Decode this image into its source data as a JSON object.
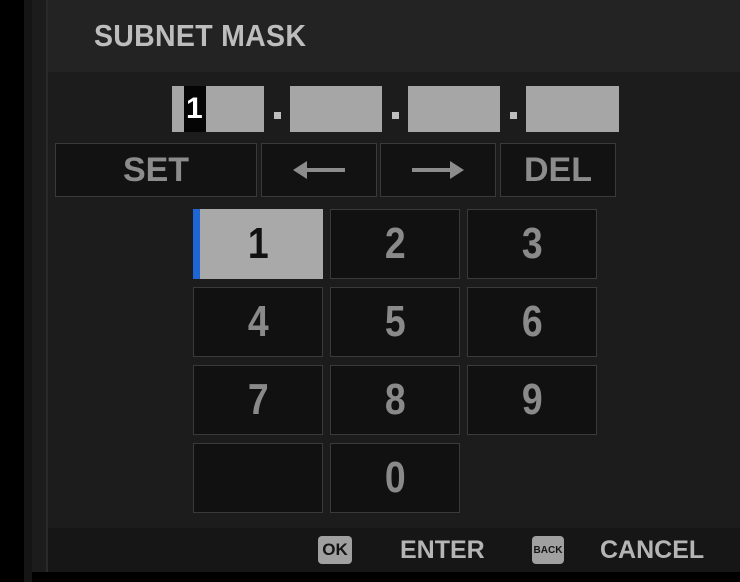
{
  "header": {
    "title": "SUBNET MASK"
  },
  "address": {
    "cursor_digit": "1",
    "separators": [
      ".",
      ".",
      "."
    ]
  },
  "controls": {
    "set_label": "SET",
    "left_arrow_icon": "left-arrow-icon",
    "right_arrow_icon": "right-arrow-icon",
    "del_label": "DEL"
  },
  "keypad": {
    "keys": [
      "1",
      "2",
      "3",
      "4",
      "5",
      "6",
      "7",
      "8",
      "9",
      "",
      "0"
    ],
    "selected": "1"
  },
  "footer": {
    "ok_badge": "OK",
    "enter_label": "ENTER",
    "back_badge": "BACK",
    "cancel_label": "CANCEL"
  },
  "colors": {
    "background": "#1c1c1c",
    "selected_key": "#a9a9a9",
    "focus_indicator": "#1e66d4",
    "text": "#bdbdbd"
  }
}
